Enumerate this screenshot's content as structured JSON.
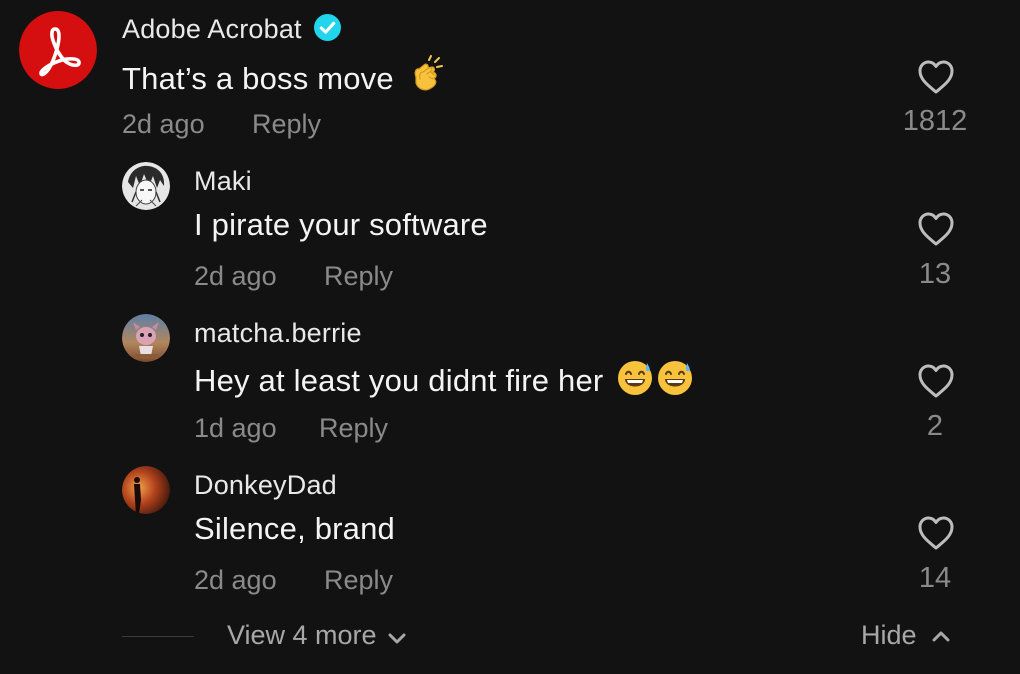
{
  "comments": [
    {
      "username": "Adobe Acrobat",
      "verified": true,
      "text": "That’s a boss move",
      "emoji": "clapping-hands",
      "age": "2d ago",
      "reply_label": "Reply",
      "likes": "1812",
      "avatar": "adobe-acrobat-logo"
    },
    {
      "username": "Maki",
      "text": "I pirate your software",
      "age": "2d ago",
      "reply_label": "Reply",
      "likes": "13",
      "avatar": "manga-character"
    },
    {
      "username": "matcha.berrie",
      "text": "Hey at least you didnt fire her",
      "emoji": "grinning-sweat x2",
      "age": "1d ago",
      "reply_label": "Reply",
      "likes": "2",
      "avatar": "pokemon-character"
    },
    {
      "username": "DonkeyDad",
      "text": "Silence, brand",
      "age": "2d ago",
      "reply_label": "Reply",
      "likes": "14",
      "avatar": "sunset-silhouette"
    }
  ],
  "footer": {
    "view_more": "View 4 more",
    "hide": "Hide"
  },
  "colors": {
    "background": "#121212",
    "adobe_red": "#d50f0f",
    "verified_blue": "#20d5ec",
    "muted_text": "#8a8a8a"
  }
}
